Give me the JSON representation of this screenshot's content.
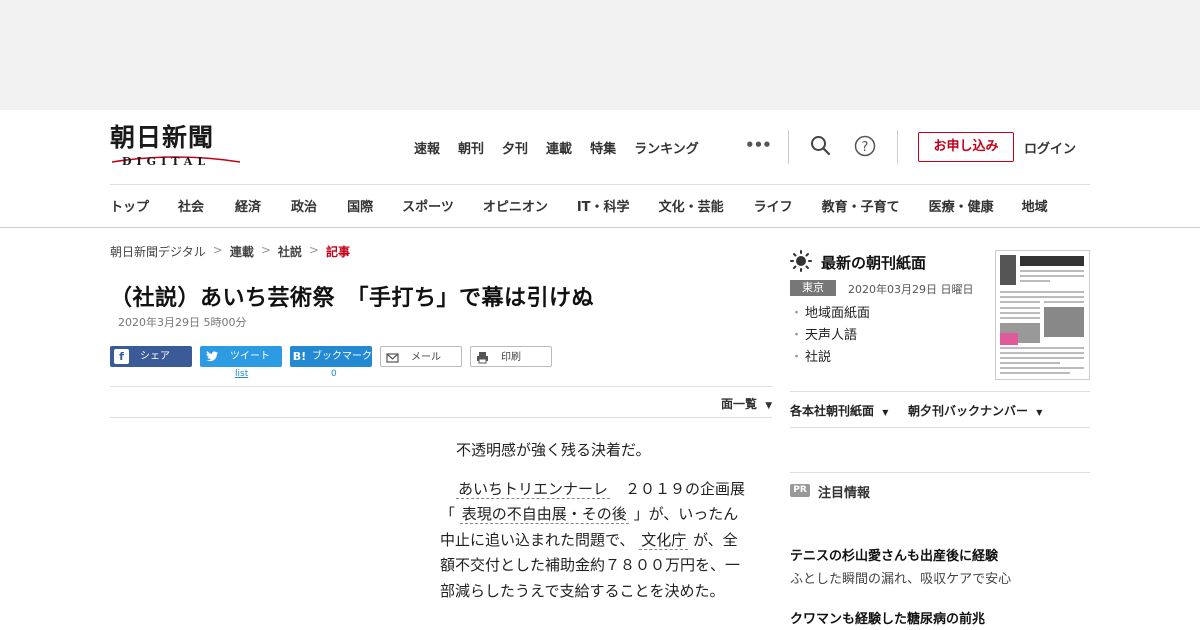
{
  "header": {
    "logo_main": "朝日新聞",
    "logo_sub": "DIGITAL",
    "top_nav": [
      "速報",
      "朝刊",
      "夕刊",
      "連載",
      "特集",
      "ランキング"
    ],
    "more": "•••",
    "subscribe": "お申し込み",
    "login": "ログイン"
  },
  "categories": [
    "トップ",
    "社会",
    "経済",
    "政治",
    "国際",
    "スポーツ",
    "オピニオン",
    "IT・科学",
    "文化・芸能",
    "ライフ",
    "教育・子育て",
    "医療・健康",
    "地域"
  ],
  "breadcrumb": [
    "朝日新聞デジタル",
    "連載",
    "社説",
    "記事"
  ],
  "article": {
    "title": "（社説）あいち芸術祭　「手打ち」で幕は引けぬ",
    "date": "2020年3月29日 5時00分",
    "share": {
      "facebook": "シェア",
      "twitter": "ツイート",
      "twitter_count": "list",
      "hatena_icon": "B!",
      "hatena": "ブックマーク",
      "hatena_count": "0",
      "mail": "メール",
      "print": "印刷"
    },
    "men_list": "面一覧",
    "p1": "不透明感が強く残る決着だ。",
    "p2_link1": "あいちトリエンナーレ",
    "p2_t1": "２０１９の企画展「",
    "p2_link2": "表現の不自由展・その後",
    "p2_t2": "」が、いったん中止に追い込まれた問題で、",
    "p2_link3": "文化庁",
    "p2_t3": "が、全額不交付とした補助金約７８００万円を、一部減らしたうえで支給することを決めた。"
  },
  "sidebar": {
    "heading": "最新の朝刊紙面",
    "edition_tag": "東京",
    "edition_date": "2020年03月29日 日曜日",
    "links": [
      "地域面紙面",
      "天声人語",
      "社説"
    ],
    "drop1": "各本社朝刊紙面",
    "drop2": "朝夕刊バックナンバー",
    "pr_tag": "PR",
    "pr_title": "注目情報",
    "pr1_head": "テニスの杉山愛さんも出産後に経験",
    "pr1_sub": "ふとした瞬間の漏れ、吸収ケアで安心",
    "pr2_head": "クワマンも経験した糖尿病の前兆"
  }
}
